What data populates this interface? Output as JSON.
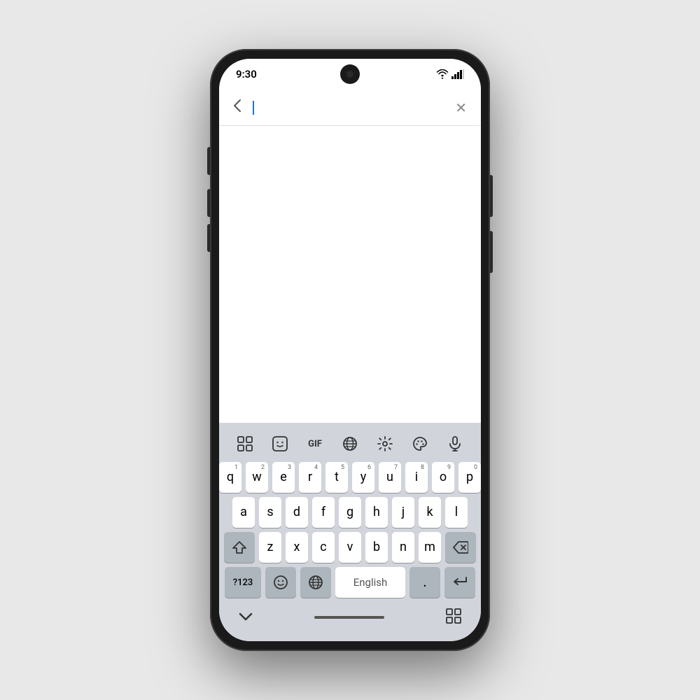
{
  "status_bar": {
    "time": "9:30"
  },
  "search_bar": {
    "back_label": "‹",
    "close_label": "✕",
    "placeholder": ""
  },
  "toolbar": {
    "items": [
      {
        "id": "emoji-grid",
        "label": "⊞",
        "type": "emoji-grid"
      },
      {
        "id": "sticker",
        "label": "🙂",
        "type": "sticker"
      },
      {
        "id": "gif",
        "label": "GIF",
        "type": "gif"
      },
      {
        "id": "translate",
        "label": "translate",
        "type": "translate"
      },
      {
        "id": "settings",
        "label": "⚙",
        "type": "settings"
      },
      {
        "id": "palette",
        "label": "🎨",
        "type": "palette"
      },
      {
        "id": "mic",
        "label": "🎤",
        "type": "mic"
      }
    ]
  },
  "keyboard": {
    "rows": [
      {
        "keys": [
          {
            "label": "q",
            "number": "1"
          },
          {
            "label": "w",
            "number": "2"
          },
          {
            "label": "e",
            "number": "3"
          },
          {
            "label": "r",
            "number": "4"
          },
          {
            "label": "t",
            "number": "5"
          },
          {
            "label": "y",
            "number": "6"
          },
          {
            "label": "u",
            "number": "7"
          },
          {
            "label": "i",
            "number": "8"
          },
          {
            "label": "o",
            "number": "9"
          },
          {
            "label": "p",
            "number": "0"
          }
        ]
      },
      {
        "keys": [
          {
            "label": "a"
          },
          {
            "label": "s"
          },
          {
            "label": "d"
          },
          {
            "label": "f"
          },
          {
            "label": "g"
          },
          {
            "label": "h"
          },
          {
            "label": "j"
          },
          {
            "label": "k"
          },
          {
            "label": "l"
          }
        ]
      },
      {
        "keys": [
          {
            "label": "z"
          },
          {
            "label": "x"
          },
          {
            "label": "c"
          },
          {
            "label": "v"
          },
          {
            "label": "b"
          },
          {
            "label": "n"
          },
          {
            "label": "m"
          }
        ]
      }
    ],
    "bottom_row": {
      "num_switch": "?123",
      "emoji_label": "😊",
      "globe_label": "🌐",
      "space_label": "English",
      "period_label": ".",
      "enter_label": "↵"
    }
  },
  "nav_bar": {
    "chevron_down": "⌄",
    "grid_icon": "⊞"
  }
}
